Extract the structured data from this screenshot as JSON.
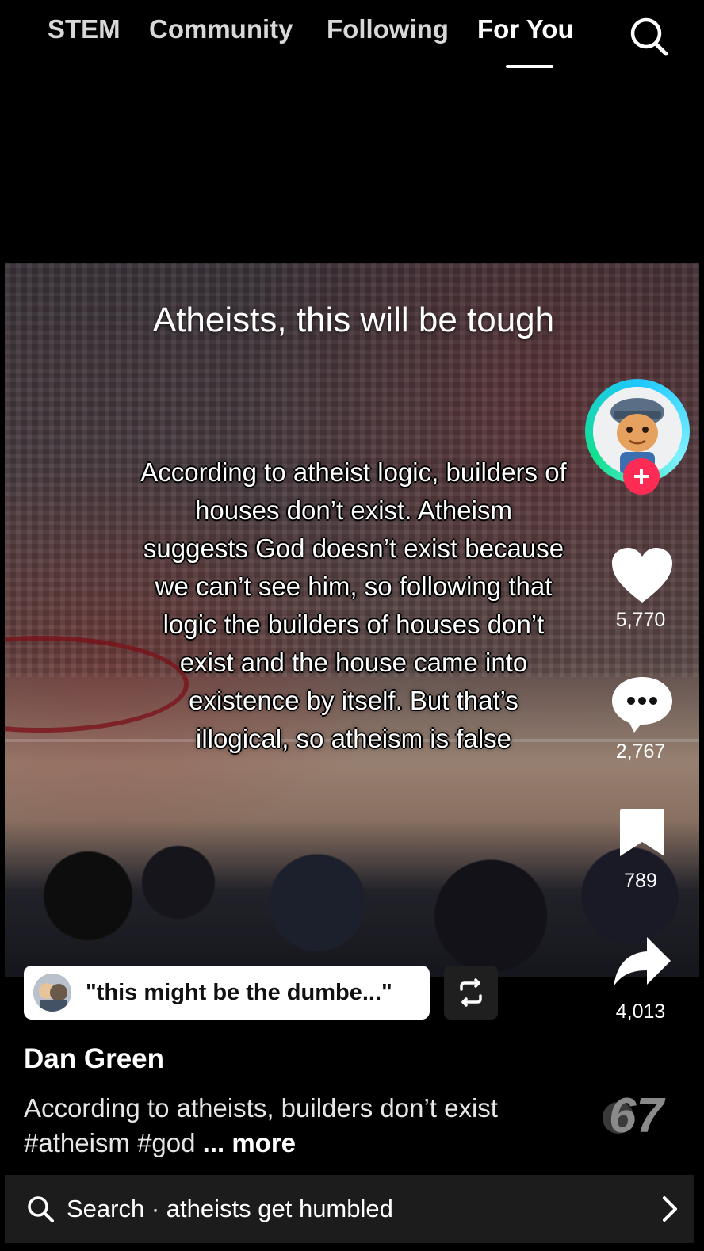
{
  "nav": {
    "tabs": [
      {
        "label": "STEM",
        "active": false
      },
      {
        "label": "Community",
        "active": false
      },
      {
        "label": "Following",
        "active": false
      },
      {
        "label": "For You",
        "active": true
      }
    ],
    "search_icon": "search-icon"
  },
  "video": {
    "title": "Atheists, this will be tough",
    "body": "According to atheist logic, builders of houses don’t exist. Atheism suggests God doesn’t exist because we can’t see him, so following that logic the builders of houses don’t exist and the house came into existence by itself. But that’s illogical, so atheism is false"
  },
  "rail": {
    "follow_label": "+",
    "likes": "5,770",
    "comments": "2,767",
    "saves": "789",
    "shares": "4,013",
    "music_badge": "67"
  },
  "quote": {
    "text": "\"this might be the dumbe...\""
  },
  "post": {
    "author": "Dan Green",
    "caption": "According to atheists, builders don’t exist #atheism #god",
    "more": "... more"
  },
  "search_bar": {
    "prefix": "Search",
    "separator": " · ",
    "query": "atheists get humbled"
  },
  "colors": {
    "accent_red": "#fe2c55",
    "ring_cyan": "#1ec7ff",
    "ring_green": "#12e08e",
    "background": "#000000"
  }
}
